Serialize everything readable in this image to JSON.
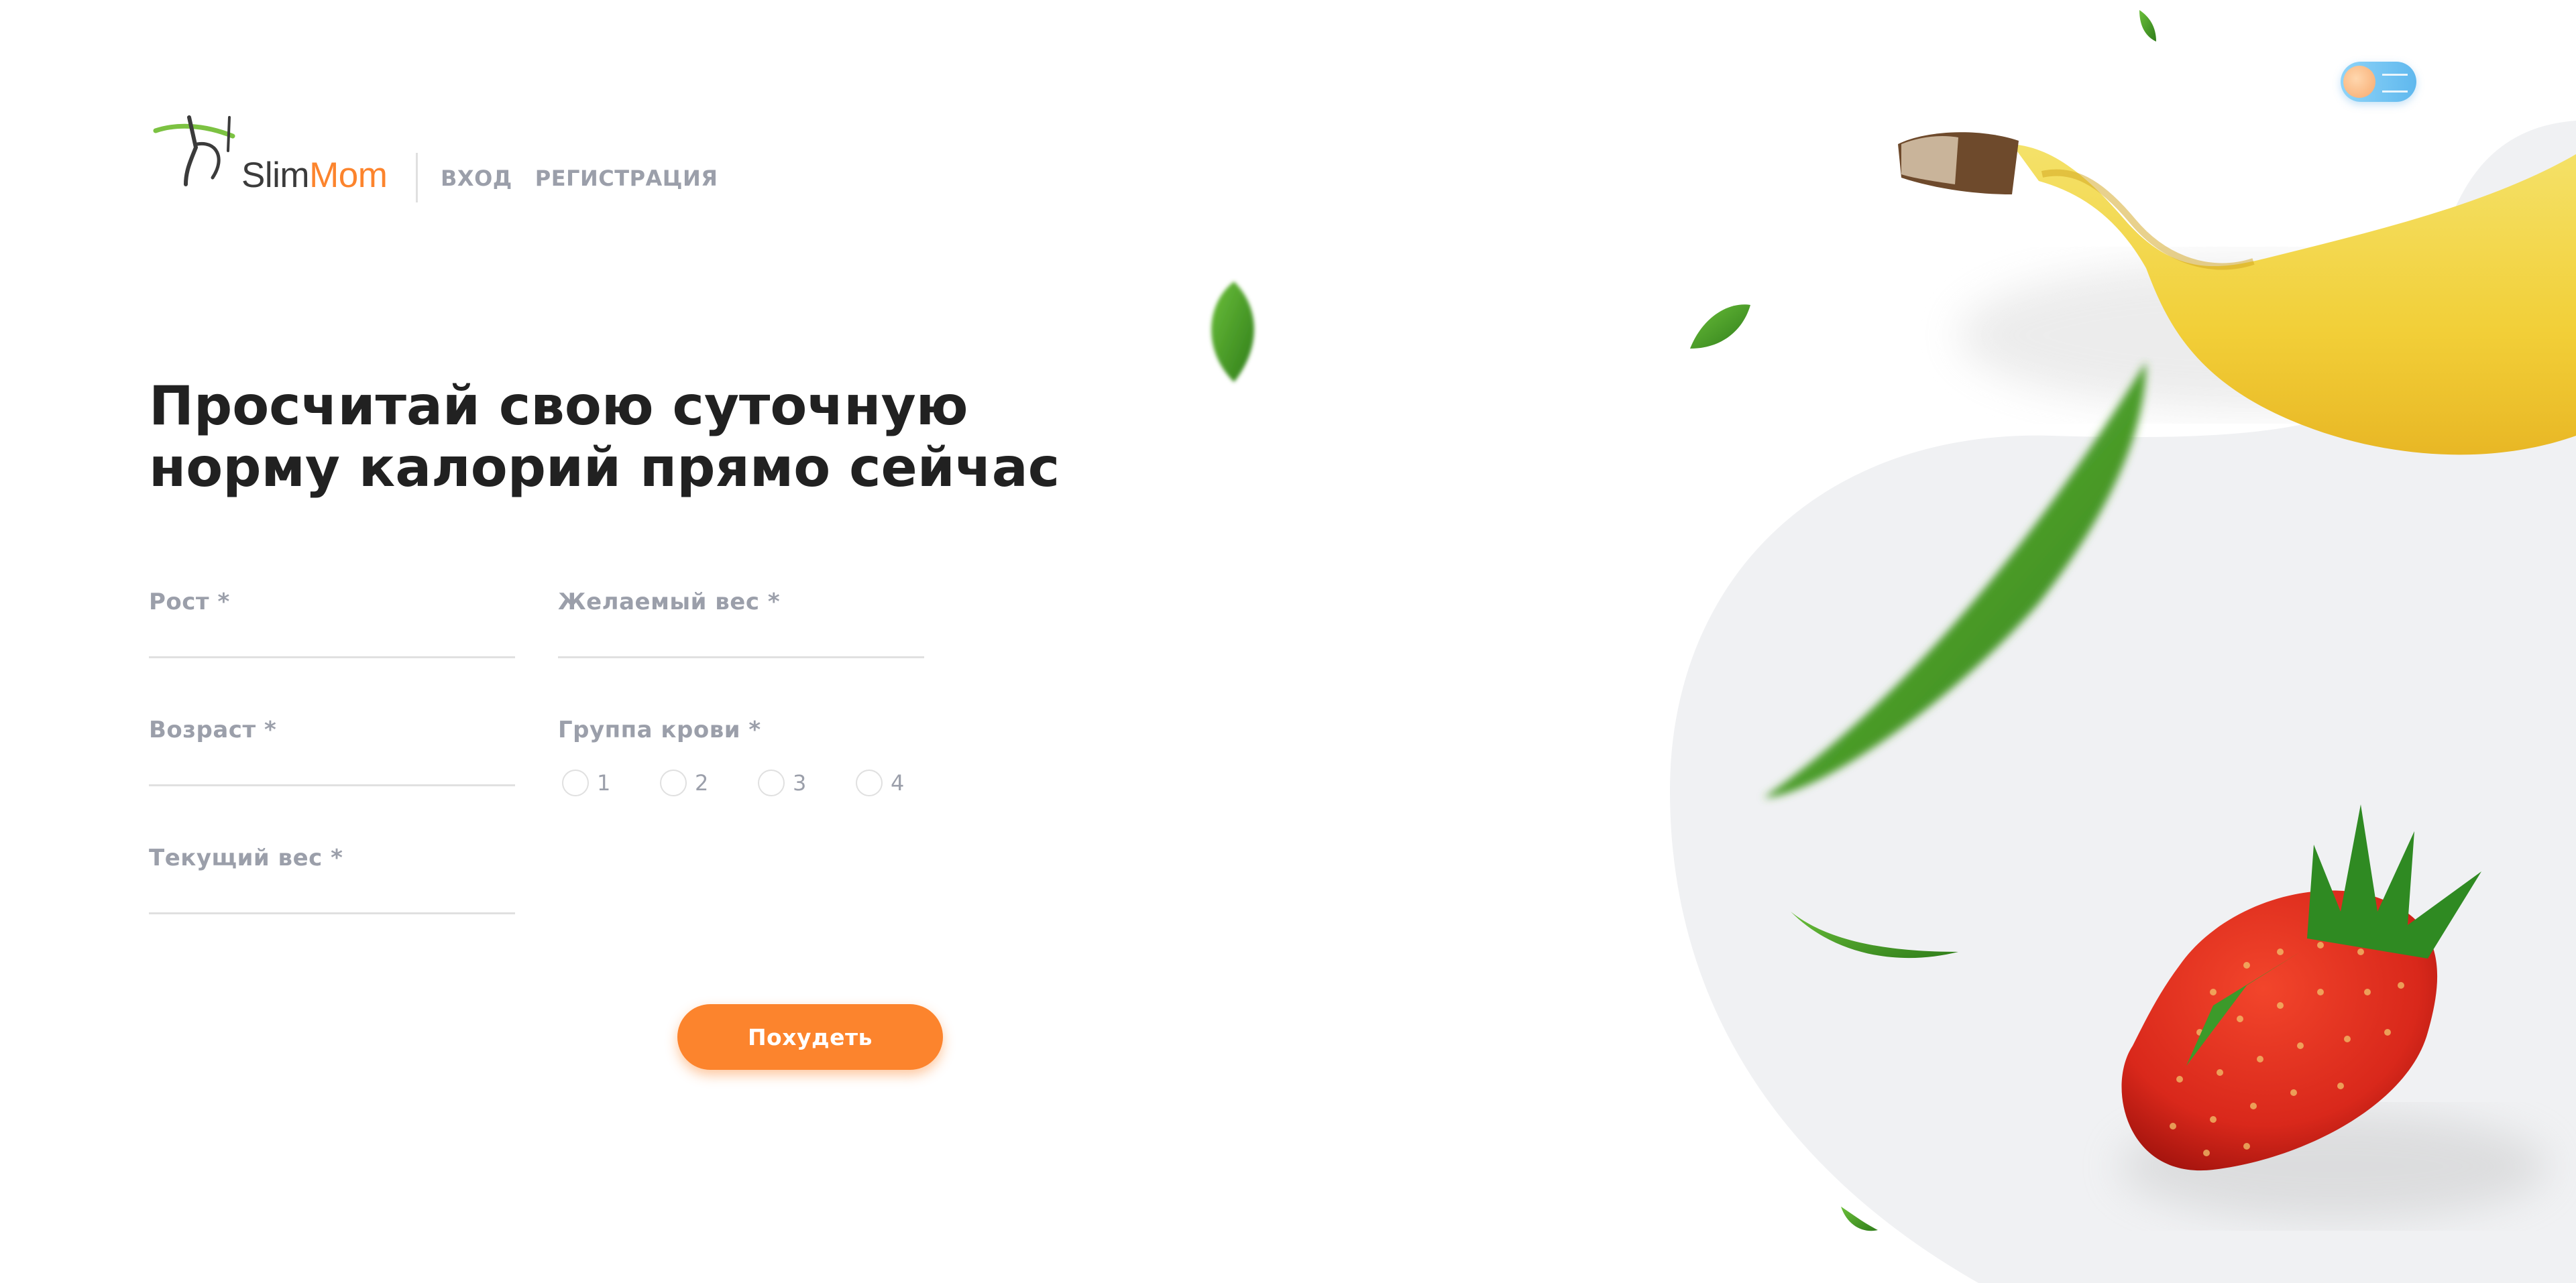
{
  "brand": {
    "name_part1": "Slim",
    "name_part2": "Mom"
  },
  "nav": {
    "login": "ВХОД",
    "register": "РЕГИСТРАЦИЯ"
  },
  "title": "Просчитай свою суточную норму калорий прямо сейчас",
  "form": {
    "height_label": "Рост *",
    "desired_weight_label": "Желаемый вес *",
    "age_label": "Возраст *",
    "blood_group_label": "Группа крови *",
    "current_weight_label": "Текущий вес *",
    "blood_groups": [
      "1",
      "2",
      "3",
      "4"
    ],
    "submit_label": "Похудеть"
  },
  "icons": {
    "logo": "slimmom-figure-logo",
    "theme_toggle": "sun-toggle-icon",
    "decorations": [
      "banana-image",
      "strawberry-image",
      "leaf-icon"
    ]
  },
  "colors": {
    "accent": "#fc842d",
    "label": "#9b9faa",
    "heading": "#212121",
    "background_blob": "#f0f1f3"
  }
}
